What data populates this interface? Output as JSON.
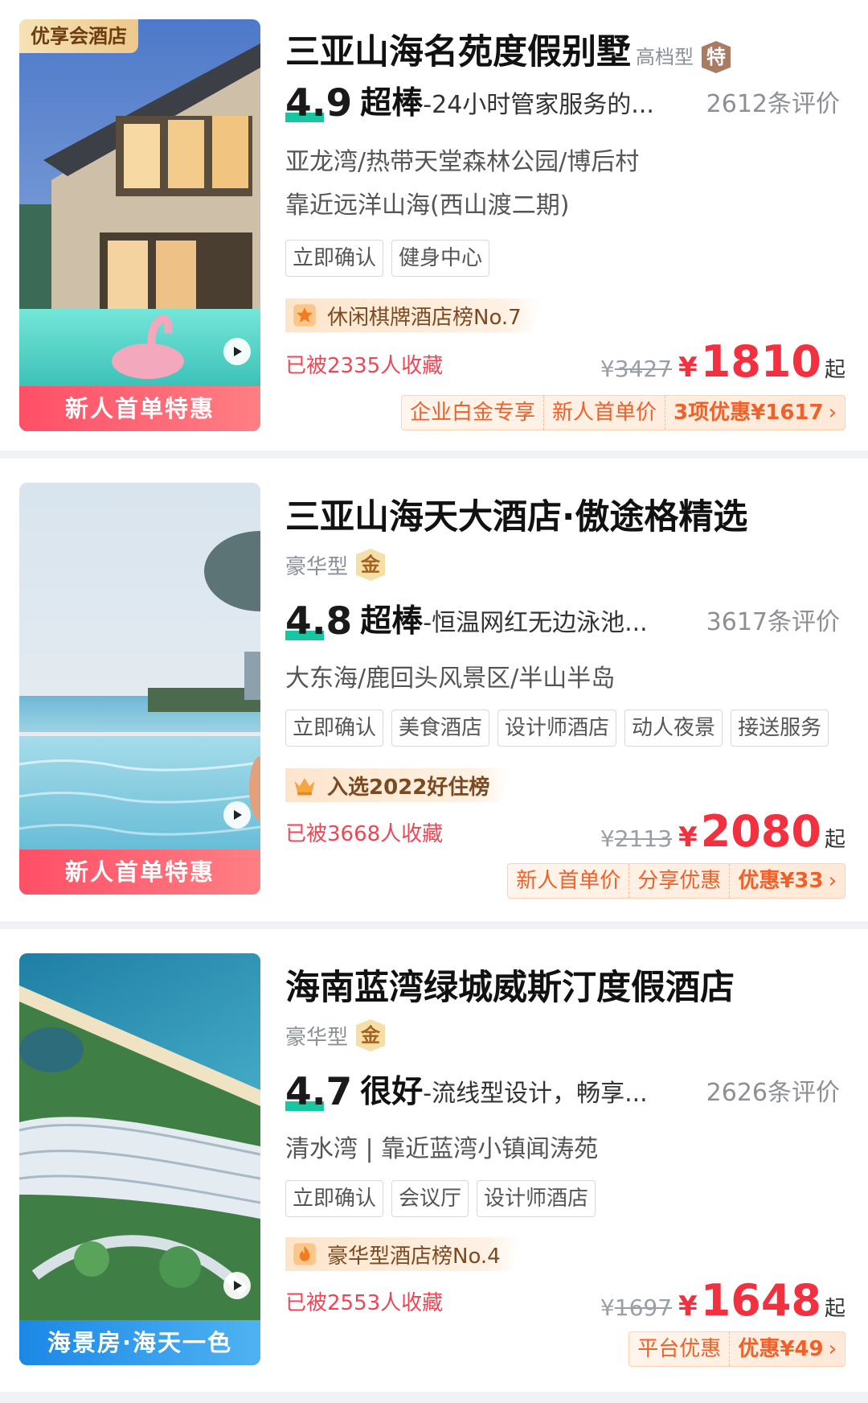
{
  "hotels": [
    {
      "badge": "优享会酒店",
      "image_promo": "新人首单特惠",
      "name": "三亚山海名苑度假别墅",
      "level": "高档型",
      "level_medal": "特",
      "score": "4.9",
      "score_word": "超棒",
      "desc": "-24小时管家服务的...",
      "reviews": "2612条评价",
      "location_lines": [
        "亚龙湾/热带天堂森林公园/博后村",
        "靠近远洋山海(西山渡二期)"
      ],
      "tags": [
        "立即确认",
        "健身中心"
      ],
      "rank_icon": "star-icon",
      "rank": "休闲棋牌酒店榜No.7",
      "favorites": "已被2335人收藏",
      "currency": "¥",
      "original_price": "3427",
      "price": "1810",
      "price_suffix": "起",
      "offers": [
        "企业白金专享",
        "新人首单价",
        "3项优惠¥1617"
      ]
    },
    {
      "badge": "",
      "image_promo": "新人首单特惠",
      "name": "三亚山海天大酒店·傲途格精选",
      "level": "豪华型",
      "level_medal": "金",
      "score": "4.8",
      "score_word": "超棒",
      "desc": "-恒温网红无边泳池...",
      "reviews": "3617条评价",
      "location_lines": [
        "大东海/鹿回头风景区/半山半岛"
      ],
      "tags": [
        "立即确认",
        "美食酒店",
        "设计师酒店",
        "动人夜景",
        "接送服务"
      ],
      "rank_icon": "crown-icon",
      "rank": "入选2022好住榜",
      "favorites": "已被3668人收藏",
      "currency": "¥",
      "original_price": "2113",
      "price": "2080",
      "price_suffix": "起",
      "offers": [
        "新人首单价",
        "分享优惠",
        "优惠¥33"
      ]
    },
    {
      "badge": "",
      "image_promo": "海景房·海天一色",
      "name": "海南蓝湾绿城威斯汀度假酒店",
      "level": "豪华型",
      "level_medal": "金",
      "score": "4.7",
      "score_word": "很好",
      "desc": "-流线型设计，畅享...",
      "reviews": "2626条评价",
      "location_lines": [
        "清水湾 | 靠近蓝湾小镇闻涛苑"
      ],
      "tags": [
        "立即确认",
        "会议厅",
        "设计师酒店"
      ],
      "rank_icon": "flame-icon",
      "rank": "豪华型酒店榜No.4",
      "favorites": "已被2553人收藏",
      "currency": "¥",
      "original_price": "1697",
      "price": "1648",
      "price_suffix": "起",
      "offers": [
        "平台优惠",
        "优惠¥49"
      ]
    }
  ],
  "colors": {
    "accent_red": "#f2303f",
    "score_green": "#16c7a1",
    "offer_orange": "#f0612a"
  }
}
